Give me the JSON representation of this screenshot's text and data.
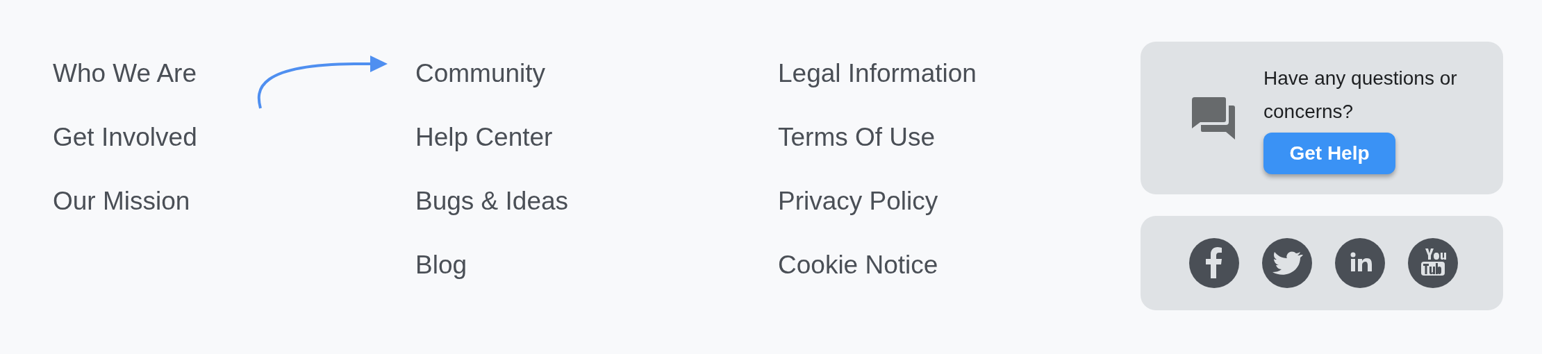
{
  "link_columns": [
    {
      "links": [
        "Who We Are",
        "Get Involved",
        "Our Mission"
      ]
    },
    {
      "links": [
        "Community",
        "Help Center",
        "Bugs & Ideas",
        "Blog"
      ]
    },
    {
      "links": [
        "Legal Information",
        "Terms Of Use",
        "Privacy Policy",
        "Cookie Notice"
      ]
    }
  ],
  "help_card": {
    "text": "Have any questions or concerns?",
    "button": "Get Help"
  },
  "social_links": [
    {
      "kind": "facebook"
    },
    {
      "kind": "twitter"
    },
    {
      "kind": "linkedin"
    },
    {
      "kind": "youtube"
    }
  ]
}
